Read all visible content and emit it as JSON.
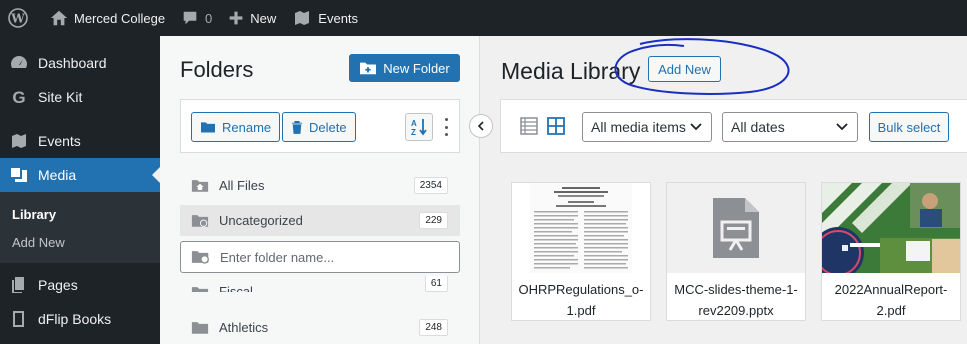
{
  "adminbar": {
    "site_name": "Merced College",
    "comments_count": "0",
    "new_label": "New",
    "events_label": "Events"
  },
  "sidebar": {
    "items": [
      {
        "label": "Dashboard",
        "icon": "dashboard-icon"
      },
      {
        "label": "Site Kit",
        "icon": "sitekit-icon"
      },
      {
        "label": "Events",
        "icon": "events-icon"
      },
      {
        "label": "Media",
        "icon": "media-icon",
        "active": true
      },
      {
        "label": "Pages",
        "icon": "pages-icon"
      },
      {
        "label": "dFlip Books",
        "icon": "book-icon"
      }
    ],
    "submenu": [
      {
        "label": "Library",
        "current": true
      },
      {
        "label": "Add New"
      }
    ]
  },
  "folders": {
    "title": "Folders",
    "new_folder_label": "New Folder",
    "rename_label": "Rename",
    "delete_label": "Delete",
    "list": [
      {
        "name": "All Files",
        "count": "2354"
      },
      {
        "name": "Uncategorized",
        "count": "229",
        "selected": true
      },
      {
        "name": "Fiscal",
        "count": "61"
      },
      {
        "name": "Athletics",
        "count": "248"
      }
    ],
    "input_placeholder": "Enter folder name..."
  },
  "main": {
    "title": "Media Library",
    "add_new_label": "Add New",
    "filter_media": "All media items",
    "filter_dates": "All dates",
    "bulk_select_label": "Bulk select",
    "items": [
      {
        "name": "OHRPRegulations_o-1.pdf",
        "type": "pdf-doc"
      },
      {
        "name": "MCC-slides-theme-1-rev2209.pptx",
        "type": "pptx"
      },
      {
        "name": "2022AnnualReport-2.pdf",
        "type": "pdf-report"
      }
    ]
  },
  "colors": {
    "admin_dark": "#1d2327",
    "accent": "#2271b1",
    "scribble": "#1a2fbf"
  }
}
